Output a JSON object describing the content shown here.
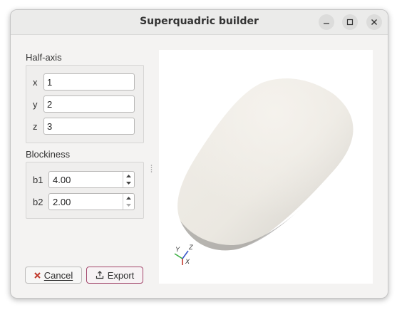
{
  "window": {
    "title": "Superquadric builder"
  },
  "halfaxis": {
    "group_label": "Half-axis",
    "fields": [
      {
        "label": "x",
        "value": "1"
      },
      {
        "label": "y",
        "value": "2"
      },
      {
        "label": "z",
        "value": "3"
      }
    ]
  },
  "blockiness": {
    "group_label": "Blockiness",
    "fields": [
      {
        "label": "b1",
        "value": "4.00"
      },
      {
        "label": "b2",
        "value": "2.00"
      }
    ]
  },
  "buttons": {
    "cancel_label": "Cancel",
    "export_label": "Export"
  },
  "viewport": {
    "axes_labels": {
      "x": "X",
      "y": "Y",
      "z": "Z"
    },
    "shape_color": "#ece9e3"
  },
  "icons": [
    "minimize-icon",
    "maximize-icon",
    "close-icon",
    "cancel-icon",
    "export-icon"
  ]
}
